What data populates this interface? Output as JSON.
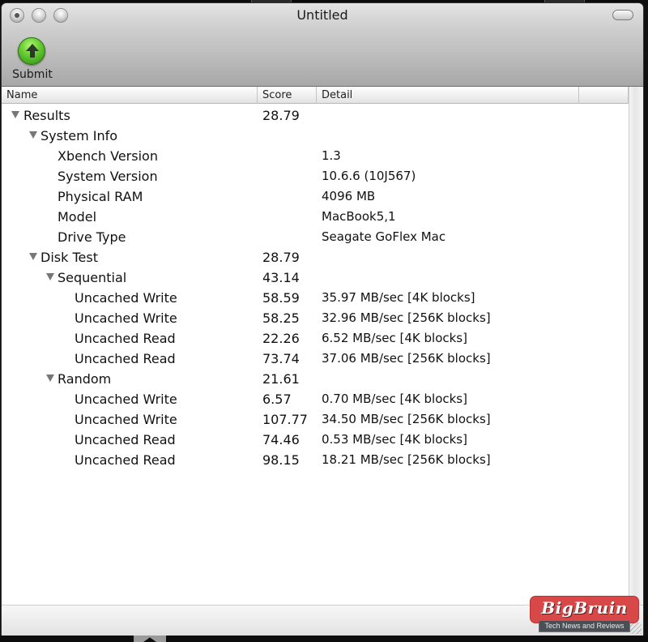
{
  "window": {
    "title": "Untitled"
  },
  "toolbar": {
    "submit_label": "Submit",
    "submit_icon": "up-arrow-circle-icon"
  },
  "table": {
    "columns": [
      "Name",
      "Score",
      "Detail",
      ""
    ],
    "rows": [
      {
        "name": "Results",
        "score": "28.79",
        "detail": "",
        "level": 0,
        "expandable": true
      },
      {
        "name": "System Info",
        "score": "",
        "detail": "",
        "level": 1,
        "expandable": true
      },
      {
        "name": "Xbench Version",
        "score": "",
        "detail": "1.3",
        "level": 2,
        "expandable": false
      },
      {
        "name": "System Version",
        "score": "",
        "detail": "10.6.6 (10J567)",
        "level": 2,
        "expandable": false
      },
      {
        "name": "Physical RAM",
        "score": "",
        "detail": "4096 MB",
        "level": 2,
        "expandable": false
      },
      {
        "name": "Model",
        "score": "",
        "detail": "MacBook5,1",
        "level": 2,
        "expandable": false
      },
      {
        "name": "Drive Type",
        "score": "",
        "detail": "Seagate GoFlex Mac",
        "level": 2,
        "expandable": false
      },
      {
        "name": "Disk Test",
        "score": "28.79",
        "detail": "",
        "level": 1,
        "expandable": true
      },
      {
        "name": "Sequential",
        "score": "43.14",
        "detail": "",
        "level": 2,
        "expandable": true
      },
      {
        "name": "Uncached Write",
        "score": "58.59",
        "detail": "35.97 MB/sec [4K blocks]",
        "level": 3,
        "expandable": false
      },
      {
        "name": "Uncached Write",
        "score": "58.25",
        "detail": "32.96 MB/sec [256K blocks]",
        "level": 3,
        "expandable": false
      },
      {
        "name": "Uncached Read",
        "score": "22.26",
        "detail": "6.52 MB/sec [4K blocks]",
        "level": 3,
        "expandable": false
      },
      {
        "name": "Uncached Read",
        "score": "73.74",
        "detail": "37.06 MB/sec [256K blocks]",
        "level": 3,
        "expandable": false
      },
      {
        "name": "Random",
        "score": "21.61",
        "detail": "",
        "level": 2,
        "expandable": true
      },
      {
        "name": "Uncached Write",
        "score": "6.57",
        "detail": "0.70 MB/sec [4K blocks]",
        "level": 3,
        "expandable": false
      },
      {
        "name": "Uncached Write",
        "score": "107.77",
        "detail": "34.50 MB/sec [256K blocks]",
        "level": 3,
        "expandable": false
      },
      {
        "name": "Uncached Read",
        "score": "74.46",
        "detail": "0.53 MB/sec [4K blocks]",
        "level": 3,
        "expandable": false
      },
      {
        "name": "Uncached Read",
        "score": "98.15",
        "detail": "18.21 MB/sec [256K blocks]",
        "level": 3,
        "expandable": false
      }
    ]
  },
  "watermark": {
    "brand": "BigBruin",
    "tagline": "Tech News and Reviews",
    "color": "#d84848"
  }
}
